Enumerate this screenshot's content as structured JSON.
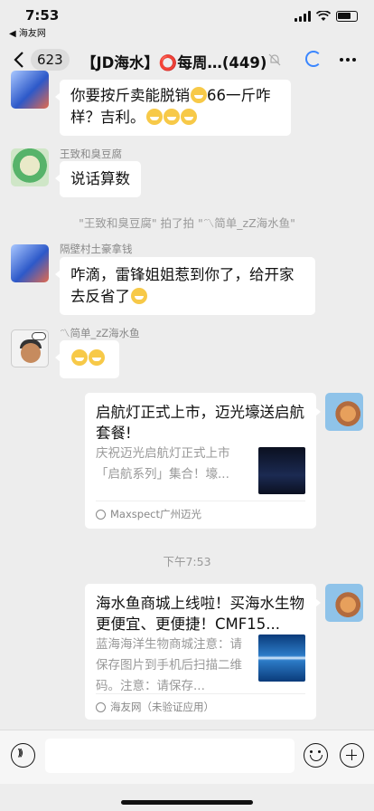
{
  "status_bar": {
    "time": "7:53",
    "back_app": "◀ 海友网"
  },
  "navbar": {
    "unread_count": "623",
    "title": "【JD海水】⭕每周…(449)"
  },
  "messages": [
    {
      "sender": "",
      "text": "你要按斤卖能脱销🤔66一斤咋样？吉利。😁😁😁"
    },
    {
      "sender": "王致和臭豆腐",
      "text": "说话算数"
    },
    {
      "system": "\"王致和臭豆腐\" 拍了拍 \"〽简单_zZ海水鱼\""
    },
    {
      "sender": "隔壁村土豪拿钱",
      "text": "咋滴，雷锋姐姐惹到你了，给开家去反省了🤔"
    },
    {
      "sender": "〽简单_zZ海水鱼",
      "text": "😅😅"
    }
  ],
  "cards": [
    {
      "title": "启航灯正式上市，迈光壕送启航套餐!",
      "desc": "庆祝迈光启航灯正式上市「启航系列」集合！壕...",
      "source": "Maxspect广州迈光"
    },
    {
      "title": "海水鱼商城上线啦！买海水生物更便宜、更便捷！CMF15...",
      "desc": "蓝海海洋生物商城注意：请保存图片到手机后扫描二维码。注意：请保存...",
      "source": "海友网（未验证应用）"
    }
  ],
  "timestamp": "下午7:53",
  "colors": {
    "background": "#ededed",
    "bubble": "#ffffff",
    "accent": "#3a86ff"
  }
}
